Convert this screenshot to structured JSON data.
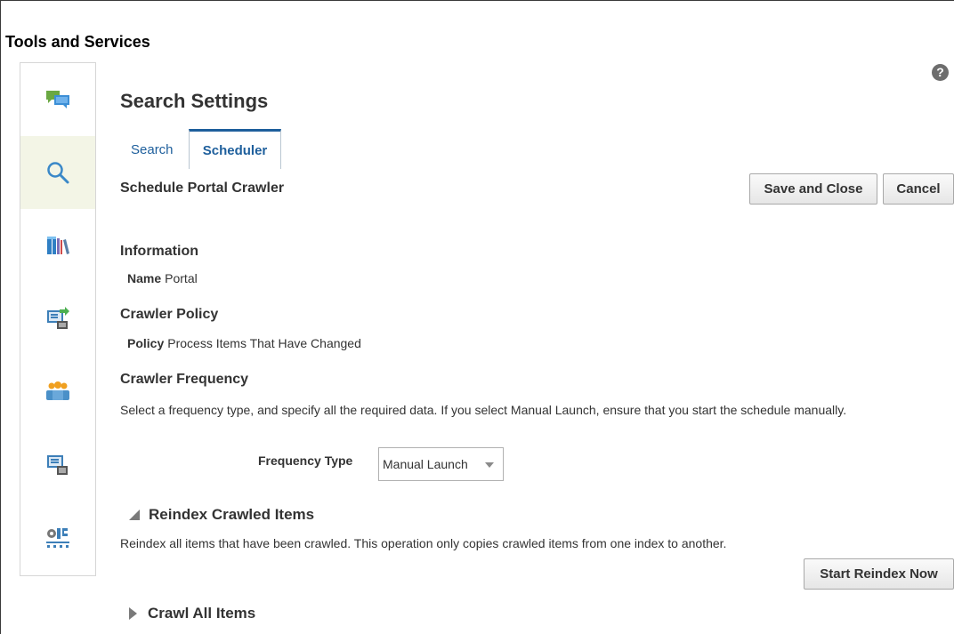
{
  "app_title": "Tools and Services",
  "help_label": "?",
  "rail": {
    "items": [
      {
        "icon": "chat-bubbles-icon"
      },
      {
        "icon": "search-icon"
      },
      {
        "icon": "library-books-icon"
      },
      {
        "icon": "export-computer-icon"
      },
      {
        "icon": "people-group-icon"
      },
      {
        "icon": "computer-users-icon"
      },
      {
        "icon": "network-transfer-icon"
      }
    ]
  },
  "main": {
    "title": "Search Settings",
    "tabs": [
      {
        "label": "Search",
        "selected": false
      },
      {
        "label": "Scheduler",
        "selected": true
      }
    ],
    "subtitle": "Schedule Portal Crawler",
    "actions": {
      "save_close": "Save and Close",
      "cancel": "Cancel"
    },
    "information": {
      "heading": "Information",
      "name_label": "Name",
      "name_value": "Portal"
    },
    "crawler_policy": {
      "heading": "Crawler Policy",
      "policy_label": "Policy",
      "policy_value": "Process Items That Have Changed"
    },
    "crawler_frequency": {
      "heading": "Crawler Frequency",
      "description": "Select a frequency type, and specify all the required data. If you select Manual Launch, ensure that you start the schedule manually.",
      "frequency_type_label": "Frequency Type",
      "frequency_type_value": "Manual Launch"
    },
    "reindex": {
      "heading": "Reindex Crawled Items",
      "expanded": true,
      "description": "Reindex all items that have been crawled. This operation only copies crawled items from one index to another.",
      "button": "Start Reindex Now"
    },
    "crawl_all": {
      "heading": "Crawl All Items",
      "expanded": false
    }
  },
  "colors": {
    "accent": "#1e5f9c",
    "rail_selected": "#f3f5e6",
    "button_border": "#a8a8a8"
  }
}
